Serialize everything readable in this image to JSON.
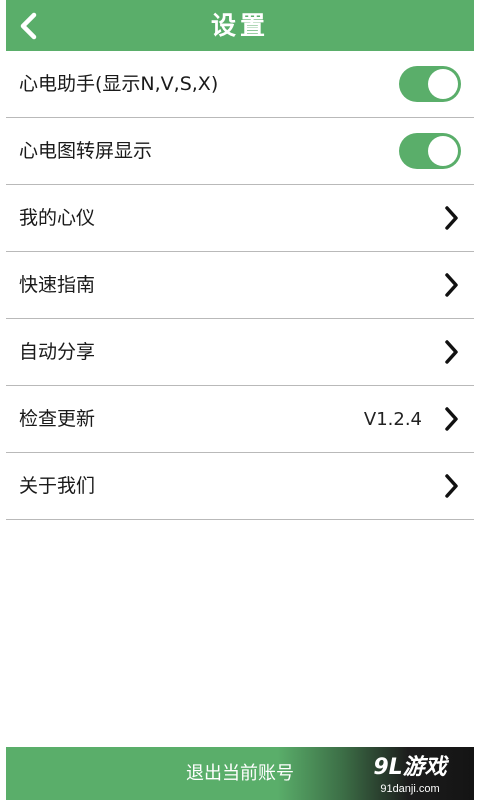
{
  "header": {
    "title": "设置"
  },
  "settings": {
    "items": [
      {
        "label": "心电助手(显示N,V,S,X)",
        "control": "toggle",
        "on": true
      },
      {
        "label": "心电图转屏显示",
        "control": "toggle",
        "on": true
      },
      {
        "label": "我的心仪",
        "control": "chevron"
      },
      {
        "label": "快速指南",
        "control": "chevron"
      },
      {
        "label": "自动分享",
        "control": "chevron"
      },
      {
        "label": "检查更新",
        "control": "chevron",
        "value": "V1.2.4"
      },
      {
        "label": "关于我们",
        "control": "chevron"
      }
    ]
  },
  "footer": {
    "logout_label": "退出当前账号"
  },
  "watermark": {
    "brand": "9L游戏",
    "url": "91danji.com"
  },
  "colors": {
    "accent": "#5aae6a",
    "divider": "#b9b9b9",
    "text": "#1a1a1a"
  }
}
